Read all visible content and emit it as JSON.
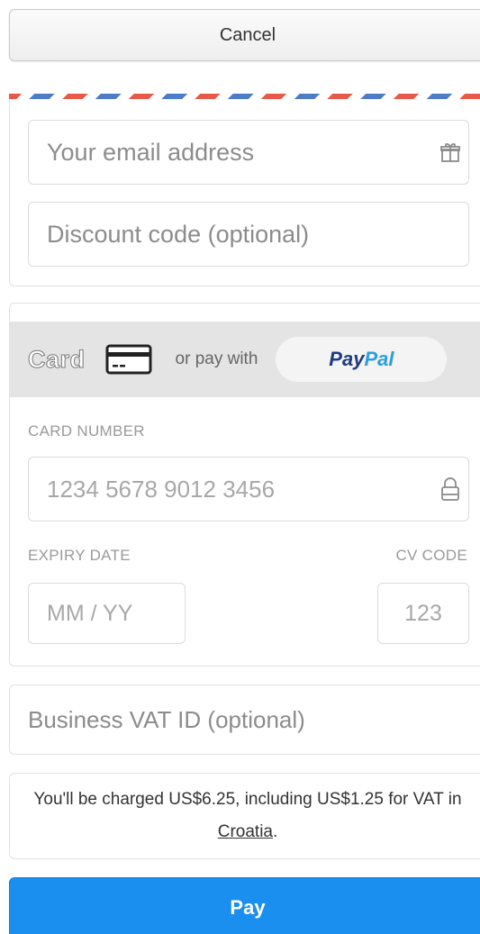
{
  "cancel_label": "Cancel",
  "colors": {
    "airmail_red": "#e8594a",
    "airmail_blue": "#4f7cc6",
    "pay_blue": "#1a8fef",
    "paypal_dark": "#1d3b82",
    "paypal_light": "#2b9fe0"
  },
  "contact": {
    "email_placeholder": "Your email address",
    "email_icon": "gift-icon",
    "discount_placeholder": "Discount code (optional)"
  },
  "payment": {
    "card_tab_label": "Card",
    "card_icon": "credit-card-icon",
    "or_pay_with": "or pay with",
    "paypal_part1": "Pay",
    "paypal_part2": "Pal",
    "card_number_label": "CARD NUMBER",
    "card_number_placeholder": "1234 5678 9012 3456",
    "card_number_icon": "lock-icon",
    "expiry_label": "EXPIRY DATE",
    "expiry_placeholder": "MM / YY",
    "cvc_label": "CV CODE",
    "cvc_placeholder": "123"
  },
  "vat": {
    "placeholder": "Business VAT ID (optional)"
  },
  "notice": {
    "text_before": "You'll be charged US$6.25, including US$1.25 for VAT in ",
    "country": "Croatia",
    "text_after": "."
  },
  "pay_label": "Pay"
}
